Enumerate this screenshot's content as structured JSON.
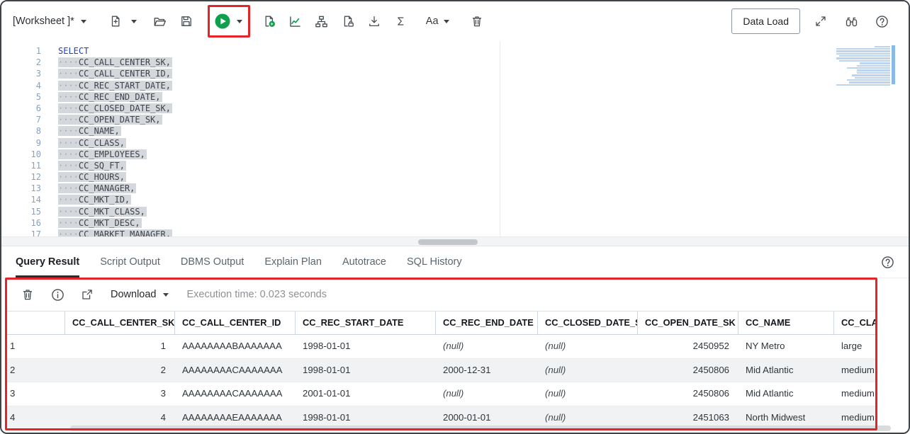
{
  "colors": {
    "highlight_red": "#e42528",
    "run_green": "#0fa04e",
    "keyword_blue": "#1b40d8",
    "selection_gray": "#d4d8dd"
  },
  "toolbar": {
    "worksheet_label": "[Worksheet ]*",
    "font_size_label": "Aa",
    "data_load_label": "Data Load",
    "icons": [
      "new-worksheet",
      "open-file",
      "save",
      "run-statement",
      "run-script",
      "explain-plan",
      "autotrace",
      "document-lock",
      "download",
      "format",
      "font-size",
      "clear",
      "expand",
      "find",
      "help"
    ]
  },
  "editor": {
    "indent_dots": "····",
    "first_line": "SELECT",
    "lines": [
      "CC_CALL_CENTER_SK,",
      "CC_CALL_CENTER_ID,",
      "CC_REC_START_DATE,",
      "CC_REC_END_DATE,",
      "CC_CLOSED_DATE_SK,",
      "CC_OPEN_DATE_SK,",
      "CC_NAME,",
      "CC_CLASS,",
      "CC_EMPLOYEES,",
      "CC_SQ_FT,",
      "CC_HOURS,",
      "CC_MANAGER,",
      "CC_MKT_ID,",
      "CC_MKT_CLASS,",
      "CC_MKT_DESC,",
      "CC_MARKET_MANAGER,"
    ]
  },
  "tabs": [
    {
      "label": "Query Result",
      "active": true
    },
    {
      "label": "Script Output",
      "active": false
    },
    {
      "label": "DBMS Output",
      "active": false
    },
    {
      "label": "Explain Plan",
      "active": false
    },
    {
      "label": "Autotrace",
      "active": false
    },
    {
      "label": "SQL History",
      "active": false
    }
  ],
  "result_toolbar": {
    "download_label": "Download",
    "execution_time": "Execution time: 0.023 seconds"
  },
  "table": {
    "columns": [
      {
        "label": "",
        "value_align": "left"
      },
      {
        "label": "CC_CALL_CENTER_SK",
        "value_align": "right"
      },
      {
        "label": "CC_CALL_CENTER_ID",
        "value_align": "left"
      },
      {
        "label": "CC_REC_START_DATE",
        "value_align": "left"
      },
      {
        "label": "CC_REC_END_DATE",
        "value_align": "left"
      },
      {
        "label": "CC_CLOSED_DATE_SK",
        "value_align": "left"
      },
      {
        "label": "CC_OPEN_DATE_SK",
        "value_align": "right"
      },
      {
        "label": "CC_NAME",
        "value_align": "left"
      },
      {
        "label": "CC_CLASS",
        "value_align": "left"
      }
    ],
    "rows": [
      [
        "1",
        "1",
        "AAAAAAAABAAAAAAA",
        "1998-01-01",
        "(null)",
        "(null)",
        "2450952",
        "NY Metro",
        "large"
      ],
      [
        "2",
        "2",
        "AAAAAAAACAAAAAAA",
        "1998-01-01",
        "2000-12-31",
        "(null)",
        "2450806",
        "Mid Atlantic",
        "medium"
      ],
      [
        "3",
        "3",
        "AAAAAAAACAAAAAAA",
        "2001-01-01",
        "(null)",
        "(null)",
        "2450806",
        "Mid Atlantic",
        "medium"
      ],
      [
        "4",
        "4",
        "AAAAAAAAEAAAAAAA",
        "1998-01-01",
        "2000-01-01",
        "(null)",
        "2451063",
        "North Midwest",
        "medium"
      ]
    ]
  }
}
